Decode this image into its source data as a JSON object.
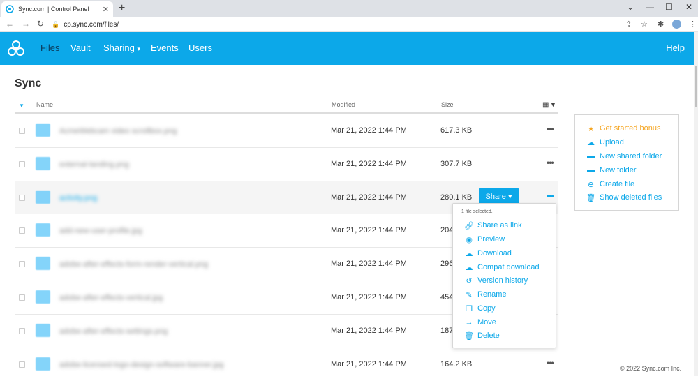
{
  "browser": {
    "tab_title": "Sync.com | Control Panel",
    "tab_close": "✕",
    "new_tab": "+",
    "url": "cp.sync.com/files/",
    "window_controls": [
      "⌄",
      "—",
      "☐",
      "✕"
    ]
  },
  "nav": {
    "items": [
      "Files",
      "Vault",
      "Sharing",
      "Events",
      "Users"
    ],
    "sharing_caret": "▾",
    "active": "Files",
    "help": "Help"
  },
  "page": {
    "title": "Sync"
  },
  "table": {
    "headers": {
      "name": "Name",
      "modified": "Modified",
      "size": "Size"
    },
    "rows": [
      {
        "name": "AcmeWebcam video scrollbox.png",
        "modified": "Mar 21, 2022 1:44 PM",
        "size": "617.3 KB",
        "selected": false
      },
      {
        "name": "external-landing.png",
        "modified": "Mar 21, 2022 1:44 PM",
        "size": "307.7 KB",
        "selected": false
      },
      {
        "name": "activity.png",
        "modified": "Mar 21, 2022 1:44 PM",
        "size": "280.1 KB",
        "selected": true
      },
      {
        "name": "add-new-user-profile.jpg",
        "modified": "Mar 21, 2022 1:44 PM",
        "size": "204",
        "selected": false
      },
      {
        "name": "adobe-after-effects-form-render-vertical.png",
        "modified": "Mar 21, 2022 1:44 PM",
        "size": "296",
        "selected": false
      },
      {
        "name": "adobe-after-effects-vertical.jpg",
        "modified": "Mar 21, 2022 1:44 PM",
        "size": "454",
        "selected": false
      },
      {
        "name": "adobe-after-effects-settings.png",
        "modified": "Mar 21, 2022 1:44 PM",
        "size": "187",
        "selected": false
      },
      {
        "name": "adobe-licensed-logo-design-software-banner.jpg",
        "modified": "Mar 21, 2022 1:44 PM",
        "size": "164.2 KB",
        "selected": false
      }
    ],
    "more_label": "•••",
    "share_button": "Share ▾"
  },
  "context_menu": {
    "selected_count": "1 file selected.",
    "items": [
      {
        "label": "Share as link",
        "icon": "link-icon"
      },
      {
        "label": "Preview",
        "icon": "eye-icon"
      },
      {
        "label": "Download",
        "icon": "cloud-download-icon"
      },
      {
        "label": "Compat download",
        "icon": "cloud-download-icon"
      },
      {
        "label": "Version history",
        "icon": "history-icon"
      },
      {
        "label": "Rename",
        "icon": "pencil-icon"
      },
      {
        "label": "Copy",
        "icon": "copy-icon"
      },
      {
        "label": "Move",
        "icon": "arrow-right-icon"
      },
      {
        "label": "Delete",
        "icon": "trash-icon"
      }
    ]
  },
  "side_panel": {
    "items": [
      {
        "label": "Get started bonus",
        "icon": "star-icon"
      },
      {
        "label": "Upload",
        "icon": "cloud-upload-icon"
      },
      {
        "label": "New shared folder",
        "icon": "shared-folder-icon"
      },
      {
        "label": "New folder",
        "icon": "folder-icon"
      },
      {
        "label": "Create file",
        "icon": "plus-circle-icon"
      },
      {
        "label": "Show deleted files",
        "icon": "trash-icon"
      }
    ]
  },
  "footer": "© 2022 Sync.com Inc.",
  "colors": {
    "brand": "#0ca8e9",
    "bonus": "#f5a623",
    "nav_active": "#0b3a5a"
  }
}
